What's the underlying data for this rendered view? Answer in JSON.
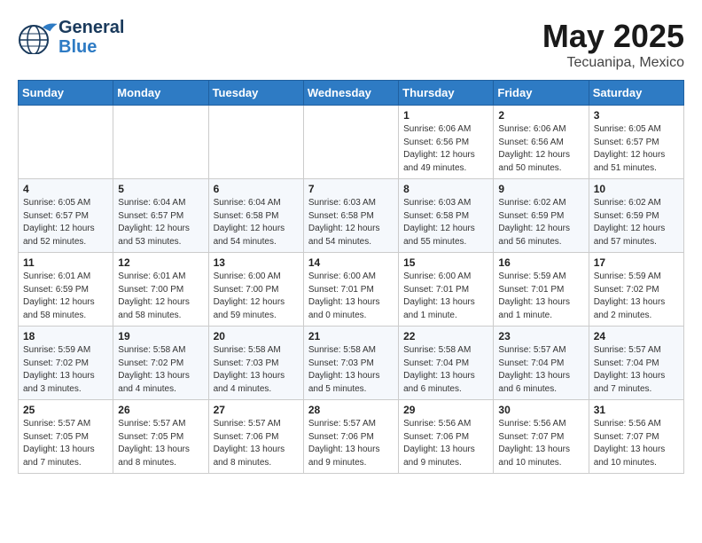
{
  "header": {
    "logo": {
      "line1": "General",
      "line2": "Blue"
    },
    "title": "May 2025",
    "subtitle": "Tecuanipa, Mexico"
  },
  "weekdays": [
    "Sunday",
    "Monday",
    "Tuesday",
    "Wednesday",
    "Thursday",
    "Friday",
    "Saturday"
  ],
  "weeks": [
    [
      {
        "day": "",
        "info": ""
      },
      {
        "day": "",
        "info": ""
      },
      {
        "day": "",
        "info": ""
      },
      {
        "day": "",
        "info": ""
      },
      {
        "day": "1",
        "info": "Sunrise: 6:06 AM\nSunset: 6:56 PM\nDaylight: 12 hours\nand 49 minutes."
      },
      {
        "day": "2",
        "info": "Sunrise: 6:06 AM\nSunset: 6:56 AM\nDaylight: 12 hours\nand 50 minutes."
      },
      {
        "day": "3",
        "info": "Sunrise: 6:05 AM\nSunset: 6:57 PM\nDaylight: 12 hours\nand 51 minutes."
      }
    ],
    [
      {
        "day": "4",
        "info": "Sunrise: 6:05 AM\nSunset: 6:57 PM\nDaylight: 12 hours\nand 52 minutes."
      },
      {
        "day": "5",
        "info": "Sunrise: 6:04 AM\nSunset: 6:57 PM\nDaylight: 12 hours\nand 53 minutes."
      },
      {
        "day": "6",
        "info": "Sunrise: 6:04 AM\nSunset: 6:58 PM\nDaylight: 12 hours\nand 54 minutes."
      },
      {
        "day": "7",
        "info": "Sunrise: 6:03 AM\nSunset: 6:58 PM\nDaylight: 12 hours\nand 54 minutes."
      },
      {
        "day": "8",
        "info": "Sunrise: 6:03 AM\nSunset: 6:58 PM\nDaylight: 12 hours\nand 55 minutes."
      },
      {
        "day": "9",
        "info": "Sunrise: 6:02 AM\nSunset: 6:59 PM\nDaylight: 12 hours\nand 56 minutes."
      },
      {
        "day": "10",
        "info": "Sunrise: 6:02 AM\nSunset: 6:59 PM\nDaylight: 12 hours\nand 57 minutes."
      }
    ],
    [
      {
        "day": "11",
        "info": "Sunrise: 6:01 AM\nSunset: 6:59 PM\nDaylight: 12 hours\nand 58 minutes."
      },
      {
        "day": "12",
        "info": "Sunrise: 6:01 AM\nSunset: 7:00 PM\nDaylight: 12 hours\nand 58 minutes."
      },
      {
        "day": "13",
        "info": "Sunrise: 6:00 AM\nSunset: 7:00 PM\nDaylight: 12 hours\nand 59 minutes."
      },
      {
        "day": "14",
        "info": "Sunrise: 6:00 AM\nSunset: 7:01 PM\nDaylight: 13 hours\nand 0 minutes."
      },
      {
        "day": "15",
        "info": "Sunrise: 6:00 AM\nSunset: 7:01 PM\nDaylight: 13 hours\nand 1 minute."
      },
      {
        "day": "16",
        "info": "Sunrise: 5:59 AM\nSunset: 7:01 PM\nDaylight: 13 hours\nand 1 minute."
      },
      {
        "day": "17",
        "info": "Sunrise: 5:59 AM\nSunset: 7:02 PM\nDaylight: 13 hours\nand 2 minutes."
      }
    ],
    [
      {
        "day": "18",
        "info": "Sunrise: 5:59 AM\nSunset: 7:02 PM\nDaylight: 13 hours\nand 3 minutes."
      },
      {
        "day": "19",
        "info": "Sunrise: 5:58 AM\nSunset: 7:02 PM\nDaylight: 13 hours\nand 4 minutes."
      },
      {
        "day": "20",
        "info": "Sunrise: 5:58 AM\nSunset: 7:03 PM\nDaylight: 13 hours\nand 4 minutes."
      },
      {
        "day": "21",
        "info": "Sunrise: 5:58 AM\nSunset: 7:03 PM\nDaylight: 13 hours\nand 5 minutes."
      },
      {
        "day": "22",
        "info": "Sunrise: 5:58 AM\nSunset: 7:04 PM\nDaylight: 13 hours\nand 6 minutes."
      },
      {
        "day": "23",
        "info": "Sunrise: 5:57 AM\nSunset: 7:04 PM\nDaylight: 13 hours\nand 6 minutes."
      },
      {
        "day": "24",
        "info": "Sunrise: 5:57 AM\nSunset: 7:04 PM\nDaylight: 13 hours\nand 7 minutes."
      }
    ],
    [
      {
        "day": "25",
        "info": "Sunrise: 5:57 AM\nSunset: 7:05 PM\nDaylight: 13 hours\nand 7 minutes."
      },
      {
        "day": "26",
        "info": "Sunrise: 5:57 AM\nSunset: 7:05 PM\nDaylight: 13 hours\nand 8 minutes."
      },
      {
        "day": "27",
        "info": "Sunrise: 5:57 AM\nSunset: 7:06 PM\nDaylight: 13 hours\nand 8 minutes."
      },
      {
        "day": "28",
        "info": "Sunrise: 5:57 AM\nSunset: 7:06 PM\nDaylight: 13 hours\nand 9 minutes."
      },
      {
        "day": "29",
        "info": "Sunrise: 5:56 AM\nSunset: 7:06 PM\nDaylight: 13 hours\nand 9 minutes."
      },
      {
        "day": "30",
        "info": "Sunrise: 5:56 AM\nSunset: 7:07 PM\nDaylight: 13 hours\nand 10 minutes."
      },
      {
        "day": "31",
        "info": "Sunrise: 5:56 AM\nSunset: 7:07 PM\nDaylight: 13 hours\nand 10 minutes."
      }
    ]
  ]
}
